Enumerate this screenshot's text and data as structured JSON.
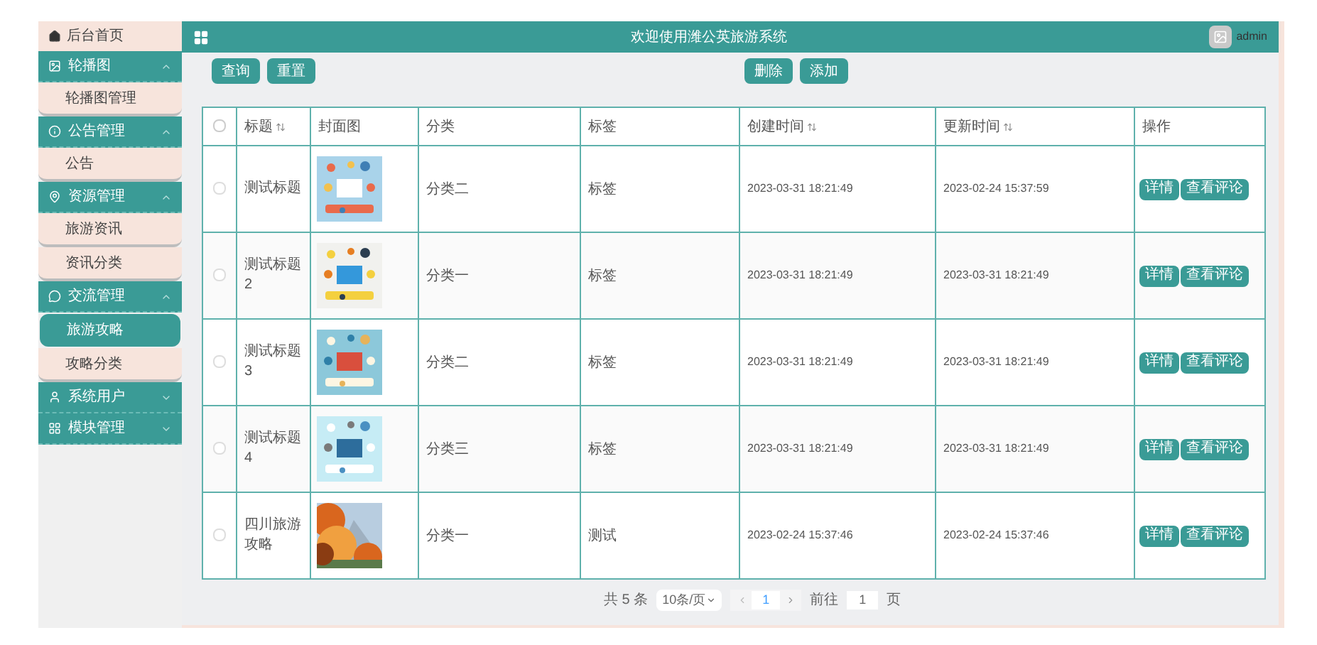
{
  "sidebar": {
    "home": "后台首页",
    "menus": [
      {
        "title": "轮播图",
        "expanded": true,
        "items": [
          {
            "label": "轮播图管理",
            "selected": false
          }
        ]
      },
      {
        "title": "公告管理",
        "expanded": true,
        "items": [
          {
            "label": "公告",
            "selected": false
          }
        ]
      },
      {
        "title": "资源管理",
        "expanded": true,
        "items": [
          {
            "label": "旅游资讯",
            "selected": false
          },
          {
            "label": "资讯分类",
            "selected": false
          }
        ]
      },
      {
        "title": "交流管理",
        "expanded": true,
        "items": [
          {
            "label": "旅游攻略",
            "selected": true
          },
          {
            "label": "攻略分类",
            "selected": false
          }
        ]
      },
      {
        "title": "系统用户",
        "expanded": false
      },
      {
        "title": "模块管理",
        "expanded": false
      }
    ]
  },
  "header": {
    "title": "欢迎使用潍公英旅游系统",
    "user": "admin"
  },
  "toolbar": {
    "left": [
      "查询",
      "重置"
    ],
    "right": [
      "删除",
      "添加"
    ]
  },
  "table": {
    "header_checked": false,
    "columns": [
      {
        "label": "标题",
        "sortable": true
      },
      {
        "label": "封面图",
        "sortable": false
      },
      {
        "label": "分类",
        "sortable": false
      },
      {
        "label": "标签",
        "sortable": false
      },
      {
        "label": "创建时间",
        "sortable": true
      },
      {
        "label": "更新时间",
        "sortable": true
      },
      {
        "label": "操作",
        "sortable": false
      }
    ],
    "rows": [
      {
        "checked": false,
        "title": "测试标题",
        "category": "分类二",
        "tag": "标签",
        "created": "2023-03-31 18:21:49",
        "updated": "2023-02-24 15:37:59",
        "actions": [
          "详情",
          "查看评论"
        ]
      },
      {
        "checked": false,
        "title": "测试标题2",
        "category": "分类一",
        "tag": "标签",
        "created": "2023-03-31 18:21:49",
        "updated": "2023-03-31 18:21:49",
        "actions": [
          "详情",
          "查看评论"
        ]
      },
      {
        "checked": false,
        "title": "测试标题3",
        "category": "分类二",
        "tag": "标签",
        "created": "2023-03-31 18:21:49",
        "updated": "2023-03-31 18:21:49",
        "actions": [
          "详情",
          "查看评论"
        ]
      },
      {
        "checked": false,
        "title": "测试标题4",
        "category": "分类三",
        "tag": "标签",
        "created": "2023-03-31 18:21:49",
        "updated": "2023-03-31 18:21:49",
        "actions": [
          "详情",
          "查看评论"
        ]
      },
      {
        "checked": false,
        "title": "四川旅游攻略",
        "category": "分类一",
        "tag": "测试",
        "created": "2023-02-24 15:37:46",
        "updated": "2023-02-24 15:37:46",
        "actions": [
          "详情",
          "查看评论"
        ]
      }
    ]
  },
  "pagination": {
    "total": "共 5 条",
    "page_size": "10条/页",
    "pages": [
      {
        "label": "1",
        "selected": true
      }
    ],
    "goto_label": "前往",
    "goto_value": "1",
    "goto_suffix": "页"
  }
}
